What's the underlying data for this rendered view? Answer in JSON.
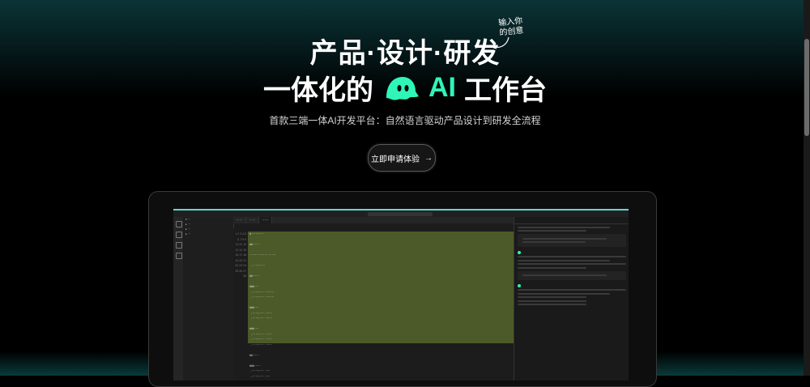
{
  "hero": {
    "line1": "产品·设计·研发",
    "line2_left": "一体化的",
    "line2_ai": "AI",
    "line2_right": "工作台",
    "hint_line1": "输入你",
    "hint_line2": "的创意",
    "subtitle": "首款三端一体AI开发平台：自然语言驱动产品设计到研发全流程",
    "cta_label": "立即申请体验",
    "cta_arrow": "→"
  },
  "colors": {
    "accent": "#2ff5b8",
    "background": "#000000",
    "code_highlight": "#4c5a2a"
  },
  "icons": {
    "logo": "ghost-icon",
    "cta": "arrow-right-icon",
    "hint": "curved-arrow-icon"
  }
}
